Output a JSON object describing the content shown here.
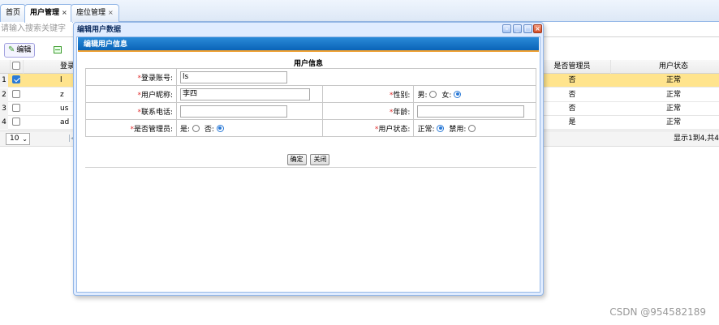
{
  "tabs": [
    {
      "label": "首页",
      "closable": false,
      "active": false
    },
    {
      "label": "用户管理",
      "closable": true,
      "active": true
    },
    {
      "label": "座位管理",
      "closable": true,
      "active": false
    }
  ],
  "tab_close_glyph": "×",
  "search": {
    "placeholder": "请输入搜索关键字"
  },
  "toolbar": {
    "edit_label": "编辑",
    "edit_icon": "pencil-icon",
    "second_icon": "remove-icon"
  },
  "grid": {
    "columns": {
      "login": "登录",
      "admin": "是否管理员",
      "status": "用户状态"
    },
    "rows": [
      {
        "n": "1",
        "checked": true,
        "login": "l",
        "admin": "否",
        "status": "正常"
      },
      {
        "n": "2",
        "checked": false,
        "login": "z",
        "admin": "否",
        "status": "正常"
      },
      {
        "n": "3",
        "checked": false,
        "login": "us",
        "admin": "否",
        "status": "正常"
      },
      {
        "n": "4",
        "checked": false,
        "login": "ad",
        "admin": "是",
        "status": "正常"
      }
    ]
  },
  "pager": {
    "page_size": "10",
    "info": "显示1到4,共4"
  },
  "dialog": {
    "title": "编辑用户数据",
    "panel_title": "编辑用户信息",
    "form_title": "用户信息",
    "required_mark": "*",
    "fields": {
      "login_label": "登录账号:",
      "login_value": "ls",
      "nickname_label": "用户昵称:",
      "nickname_value": "李四",
      "gender_label": "性别:",
      "gender_male": "男:",
      "gender_female": "女:",
      "phone_label": "联系电话:",
      "phone_value": "",
      "age_label": "年龄:",
      "age_value": "",
      "admin_label": "是否管理员:",
      "admin_yes": "是:",
      "admin_no": "否:",
      "status_label": "用户状态:",
      "status_normal": "正常:",
      "status_disabled": "禁用:"
    },
    "ok_label": "确定",
    "close_label": "关闭"
  },
  "watermark": "CSDN @954582189"
}
